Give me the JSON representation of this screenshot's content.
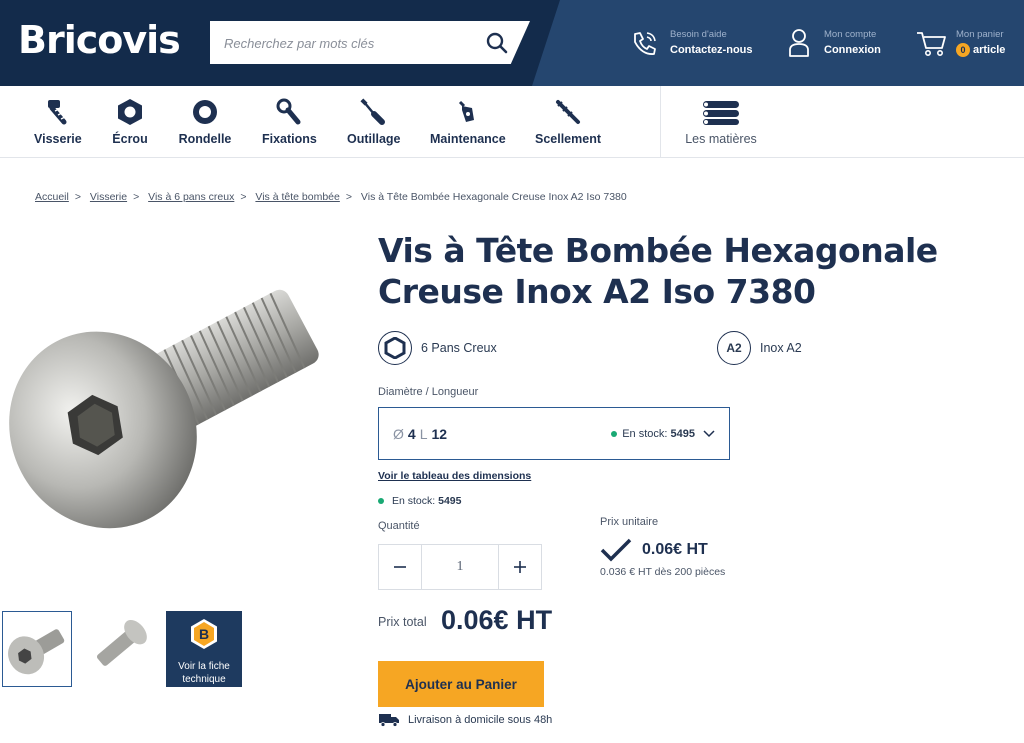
{
  "header": {
    "logo": "Bricovis",
    "search_placeholder": "Recherchez par mots clés",
    "help": {
      "small": "Besoin d'aide",
      "big": "Contactez-nous",
      "icon": "phone-icon"
    },
    "account": {
      "small": "Mon compte",
      "big": "Connexion",
      "icon": "user-icon"
    },
    "cart": {
      "small": "Mon panier",
      "count": "0",
      "big": "article",
      "icon": "cart-icon"
    }
  },
  "nav": {
    "items": [
      {
        "label": "Visserie",
        "icon": "screw-icon"
      },
      {
        "label": "Écrou",
        "icon": "nut-icon"
      },
      {
        "label": "Rondelle",
        "icon": "washer-icon"
      },
      {
        "label": "Fixations",
        "icon": "fixing-icon"
      },
      {
        "label": "Outillage",
        "icon": "tool-icon"
      },
      {
        "label": "Maintenance",
        "icon": "maintenance-icon"
      },
      {
        "label": "Scellement",
        "icon": "anchor-icon"
      }
    ],
    "materials_label": "Les matières"
  },
  "breadcrumb": [
    "Accueil",
    "Visserie",
    "Vis à 6 pans creux",
    "Vis à tête bombée",
    "Vis à Tête Bombée Hexagonale Creuse Inox A2 Iso 7380"
  ],
  "product": {
    "title": "Vis à Tête Bombée Hexagonale Creuse Inox A2 Iso 7380",
    "attr_drive": "6 Pans Creux",
    "attr_material_badge": "A2",
    "attr_material": "Inox A2",
    "field_label": "Diamètre / Longueur",
    "variant": {
      "diameter_symbol": "Ø",
      "diameter": "4",
      "length_symbol": "L",
      "length": "12",
      "stock_label": "En stock:",
      "stock_qty": "5495"
    },
    "dim_link": "Voir le tableau des dimensions",
    "stock_label": "En stock:",
    "stock_qty": "5495",
    "qty_label": "Quantité",
    "qty_value": "1",
    "unit_label": "Prix unitaire",
    "unit_price": "0.06€ HT",
    "unit_sub": "0.036 € HT dès 200 pièces",
    "total_label": "Prix total",
    "total_price": "0.06€ HT",
    "cart_button": "Ajouter au Panier",
    "delivery": "Livraison à domicile sous 48h",
    "tech_sheet": "Voir la fiche technique",
    "tech_sheet_badge": "B"
  },
  "colors": {
    "header_dark": "#132b4b",
    "header_light": "#25466f",
    "accent": "#f6a623",
    "text": "#1e3050",
    "stock_green": "#19a974"
  }
}
